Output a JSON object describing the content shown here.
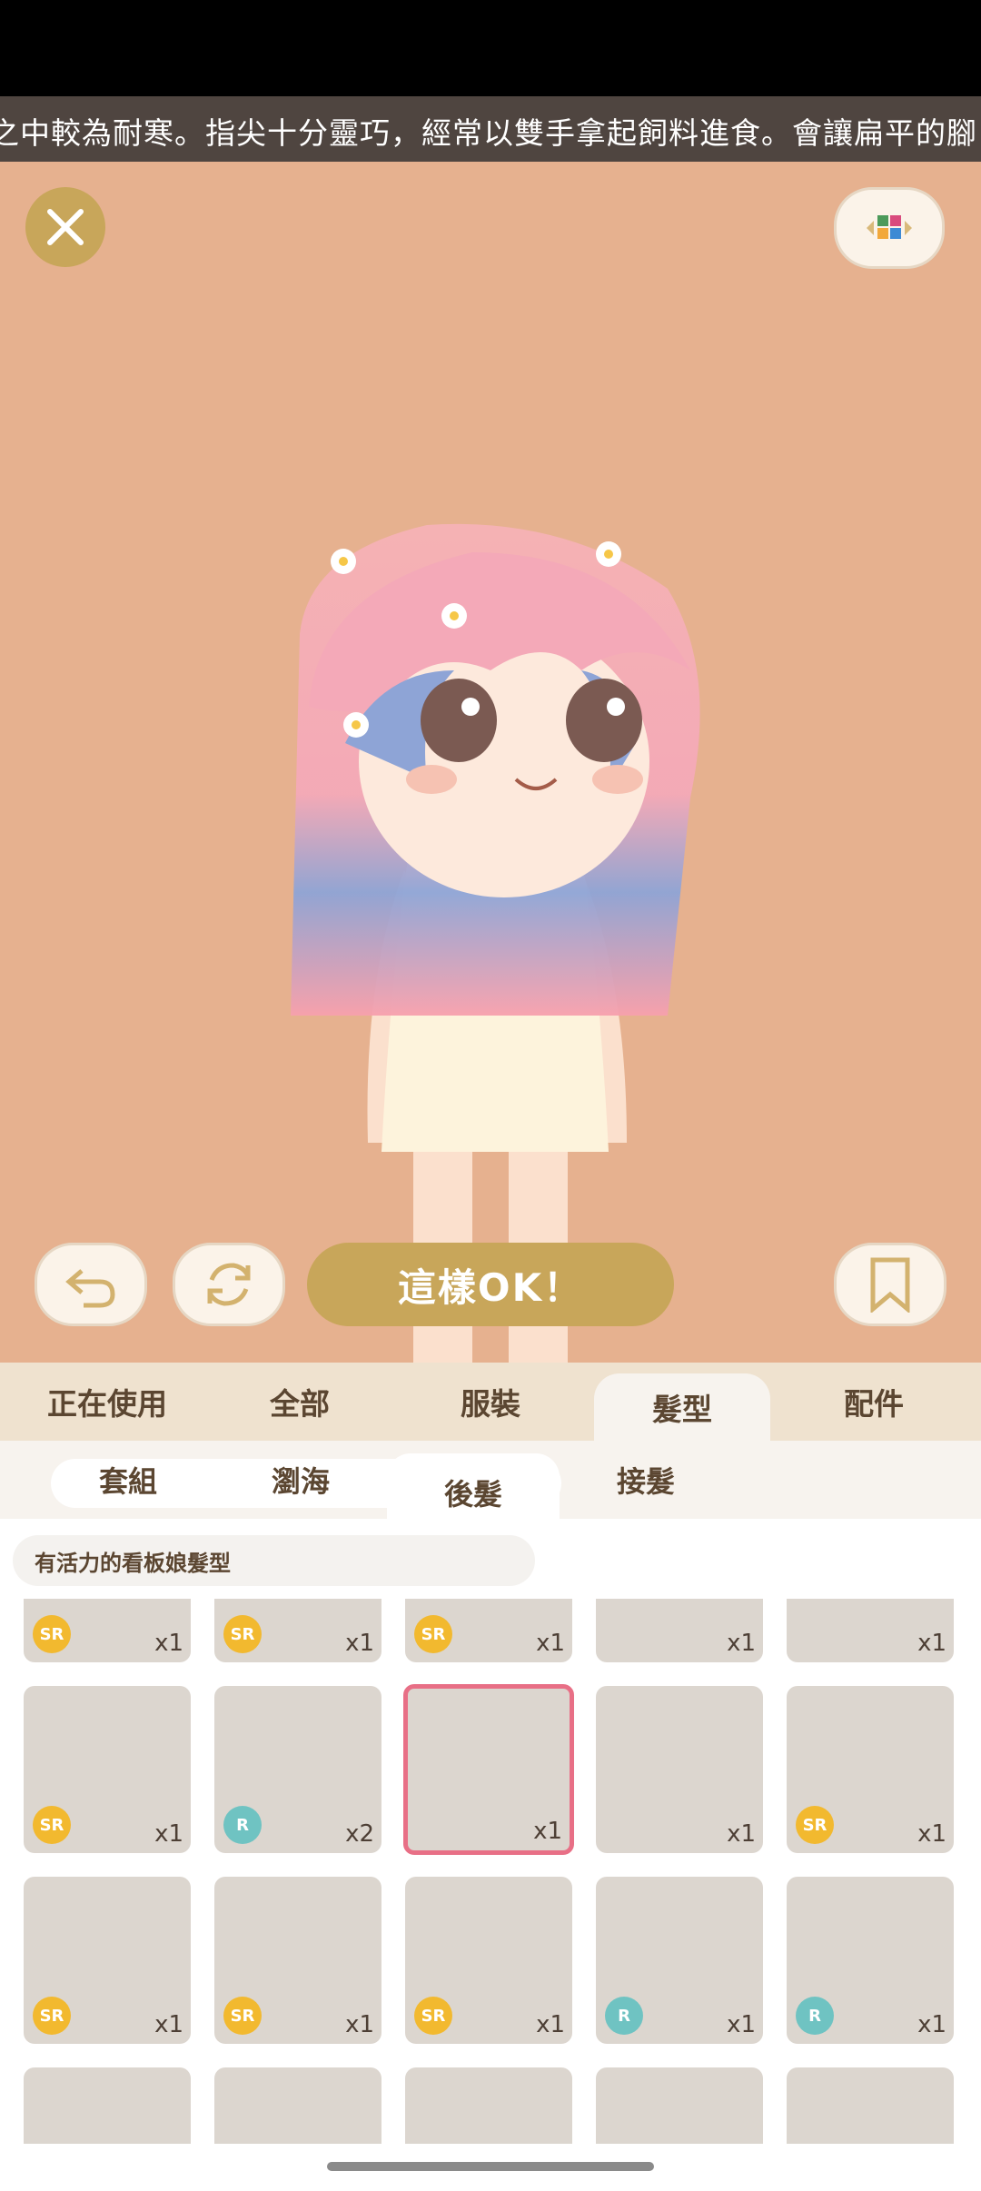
{
  "ticker": {
    "text": "之中較為耐寒。指尖十分靈巧，經常以雙手拿起飼料進食。會讓扁平的腳"
  },
  "controls": {
    "ok_label": "這樣OK！"
  },
  "tabs": {
    "items": [
      "正在使用",
      "全部",
      "服裝",
      "髮型",
      "配件"
    ],
    "active": "髮型"
  },
  "subtabs": {
    "items": [
      "套組",
      "瀏海",
      "後髮",
      "接髮"
    ],
    "active": "後髮"
  },
  "filter": {
    "label": "有活力的看板娘髮型"
  },
  "items": {
    "row1": [
      {
        "rarity": "SR",
        "qty": "x1"
      },
      {
        "rarity": "SR",
        "qty": "x1"
      },
      {
        "rarity": "SR",
        "qty": "x1"
      },
      {
        "rarity": "",
        "qty": "x1"
      },
      {
        "rarity": "",
        "qty": "x1"
      }
    ],
    "row2": [
      {
        "rarity": "SR",
        "qty": "x1"
      },
      {
        "rarity": "R",
        "qty": "x2"
      },
      {
        "rarity": "",
        "qty": "x1",
        "selected": true
      },
      {
        "rarity": "",
        "qty": "x1"
      },
      {
        "rarity": "SR",
        "qty": "x1"
      }
    ],
    "row3": [
      {
        "rarity": "SR",
        "qty": "x1"
      },
      {
        "rarity": "SR",
        "qty": "x1"
      },
      {
        "rarity": "SR",
        "qty": "x1"
      },
      {
        "rarity": "R",
        "qty": "x1"
      },
      {
        "rarity": "R",
        "qty": "x1"
      }
    ]
  },
  "colors": {
    "stage_bg": "#e6b18f",
    "accent_gold": "#c8a65a",
    "selected_border": "#e86f86"
  }
}
